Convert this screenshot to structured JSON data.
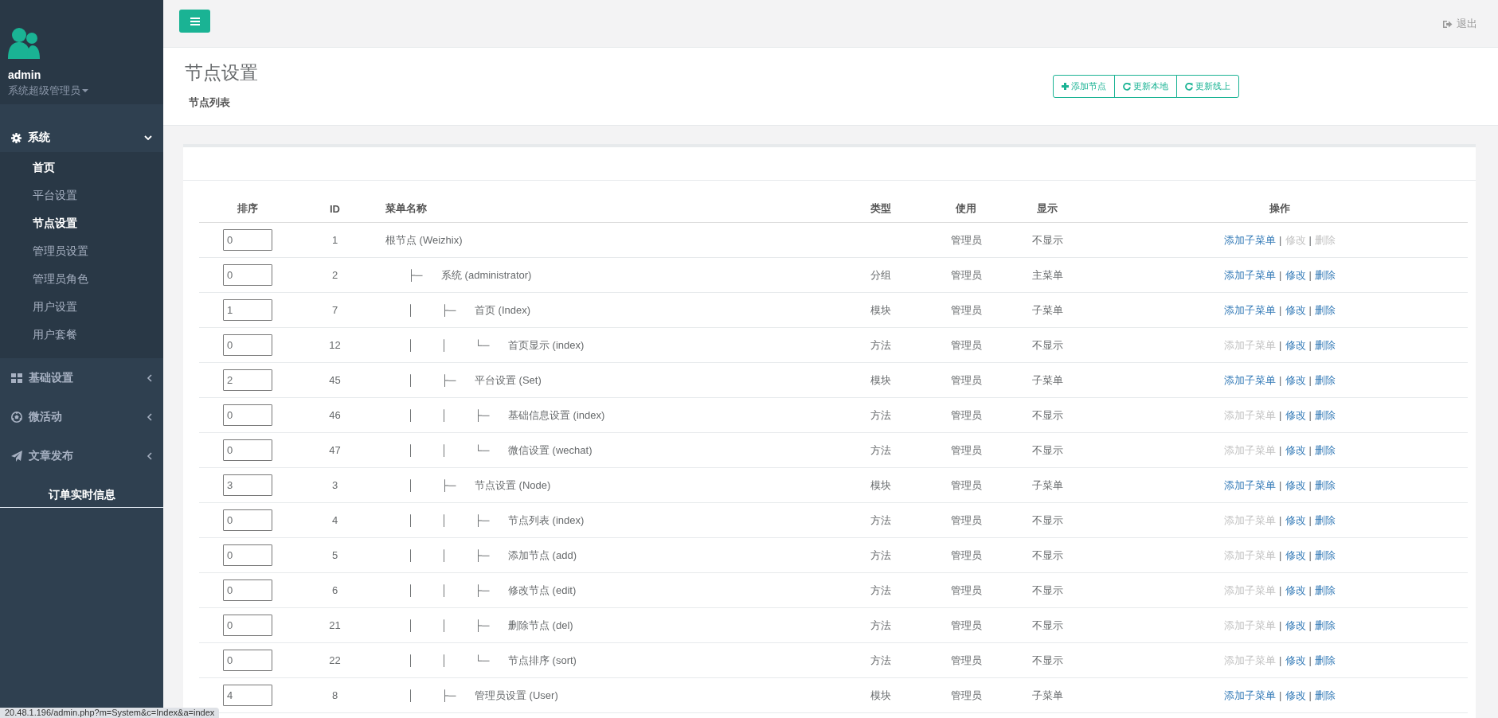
{
  "sidebar": {
    "user": {
      "name": "admin",
      "role": "系统超级管理员"
    },
    "menu": [
      {
        "kind": "group",
        "label": "系统",
        "expanded": true,
        "children": [
          {
            "label": "首页",
            "active": true
          },
          {
            "label": "平台设置",
            "active": false
          },
          {
            "label": "节点设置",
            "active": true
          },
          {
            "label": "管理员设置",
            "active": false
          },
          {
            "label": "管理员角色",
            "active": false
          },
          {
            "label": "用户设置",
            "active": false
          },
          {
            "label": "用户套餐",
            "active": false
          }
        ]
      },
      {
        "kind": "group",
        "label": "基础设置",
        "expanded": false
      },
      {
        "kind": "group",
        "label": "微活动",
        "expanded": false
      },
      {
        "kind": "group",
        "label": "文章发布",
        "expanded": false
      },
      {
        "kind": "plain",
        "label": "订单实时信息"
      }
    ]
  },
  "topbar": {
    "logout": "退出"
  },
  "header": {
    "title": "节点设置",
    "subtitle": "节点列表",
    "buttons": [
      "添加节点",
      "更新本地",
      "更新线上"
    ]
  },
  "table": {
    "columns": [
      "排序",
      "ID",
      "菜单名称",
      "类型",
      "使用",
      "显示",
      "操作"
    ],
    "rows": [
      {
        "sort": "0",
        "id": "1",
        "tree": [],
        "name": "根节点 (Weizhix)",
        "type": "",
        "use": "管理员",
        "show": "不显示",
        "actions": [
          {
            "label": "添加子菜单",
            "disabled": false
          },
          {
            "label": "修改",
            "disabled": true
          },
          {
            "label": "删除",
            "disabled": true
          }
        ]
      },
      {
        "sort": "0",
        "id": "2",
        "tree": [
          "├─"
        ],
        "name": "系统 (administrator)",
        "type": "分组",
        "use": "管理员",
        "show": "主菜单",
        "actions": [
          {
            "label": "添加子菜单",
            "disabled": false
          },
          {
            "label": "修改",
            "disabled": false
          },
          {
            "label": "删除",
            "disabled": false
          }
        ]
      },
      {
        "sort": "1",
        "id": "7",
        "tree": [
          "│",
          "├─"
        ],
        "name": "首页 (Index)",
        "type": "模块",
        "use": "管理员",
        "show": "子菜单",
        "actions": [
          {
            "label": "添加子菜单",
            "disabled": false
          },
          {
            "label": "修改",
            "disabled": false
          },
          {
            "label": "删除",
            "disabled": false
          }
        ]
      },
      {
        "sort": "0",
        "id": "12",
        "tree": [
          "│",
          "│",
          "└─"
        ],
        "name": "首页显示 (index)",
        "type": "方法",
        "use": "管理员",
        "show": "不显示",
        "actions": [
          {
            "label": "添加子菜单",
            "disabled": true
          },
          {
            "label": "修改",
            "disabled": false
          },
          {
            "label": "删除",
            "disabled": false
          }
        ]
      },
      {
        "sort": "2",
        "id": "45",
        "tree": [
          "│",
          "├─"
        ],
        "name": "平台设置 (Set)",
        "type": "模块",
        "use": "管理员",
        "show": "子菜单",
        "actions": [
          {
            "label": "添加子菜单",
            "disabled": false
          },
          {
            "label": "修改",
            "disabled": false
          },
          {
            "label": "删除",
            "disabled": false
          }
        ]
      },
      {
        "sort": "0",
        "id": "46",
        "tree": [
          "│",
          "│",
          "├─"
        ],
        "name": "基础信息设置 (index)",
        "type": "方法",
        "use": "管理员",
        "show": "不显示",
        "actions": [
          {
            "label": "添加子菜单",
            "disabled": true
          },
          {
            "label": "修改",
            "disabled": false
          },
          {
            "label": "删除",
            "disabled": false
          }
        ]
      },
      {
        "sort": "0",
        "id": "47",
        "tree": [
          "│",
          "│",
          "└─"
        ],
        "name": "微信设置 (wechat)",
        "type": "方法",
        "use": "管理员",
        "show": "不显示",
        "actions": [
          {
            "label": "添加子菜单",
            "disabled": true
          },
          {
            "label": "修改",
            "disabled": false
          },
          {
            "label": "删除",
            "disabled": false
          }
        ]
      },
      {
        "sort": "3",
        "id": "3",
        "tree": [
          "│",
          "├─"
        ],
        "name": "节点设置 (Node)",
        "type": "模块",
        "use": "管理员",
        "show": "子菜单",
        "actions": [
          {
            "label": "添加子菜单",
            "disabled": false
          },
          {
            "label": "修改",
            "disabled": false
          },
          {
            "label": "删除",
            "disabled": false
          }
        ]
      },
      {
        "sort": "0",
        "id": "4",
        "tree": [
          "│",
          "│",
          "├─"
        ],
        "name": "节点列表 (index)",
        "type": "方法",
        "use": "管理员",
        "show": "不显示",
        "actions": [
          {
            "label": "添加子菜单",
            "disabled": true
          },
          {
            "label": "修改",
            "disabled": false
          },
          {
            "label": "删除",
            "disabled": false
          }
        ]
      },
      {
        "sort": "0",
        "id": "5",
        "tree": [
          "│",
          "│",
          "├─"
        ],
        "name": "添加节点 (add)",
        "type": "方法",
        "use": "管理员",
        "show": "不显示",
        "actions": [
          {
            "label": "添加子菜单",
            "disabled": true
          },
          {
            "label": "修改",
            "disabled": false
          },
          {
            "label": "删除",
            "disabled": false
          }
        ]
      },
      {
        "sort": "0",
        "id": "6",
        "tree": [
          "│",
          "│",
          "├─"
        ],
        "name": "修改节点 (edit)",
        "type": "方法",
        "use": "管理员",
        "show": "不显示",
        "actions": [
          {
            "label": "添加子菜单",
            "disabled": true
          },
          {
            "label": "修改",
            "disabled": false
          },
          {
            "label": "删除",
            "disabled": false
          }
        ]
      },
      {
        "sort": "0",
        "id": "21",
        "tree": [
          "│",
          "│",
          "├─"
        ],
        "name": "删除节点 (del)",
        "type": "方法",
        "use": "管理员",
        "show": "不显示",
        "actions": [
          {
            "label": "添加子菜单",
            "disabled": true
          },
          {
            "label": "修改",
            "disabled": false
          },
          {
            "label": "删除",
            "disabled": false
          }
        ]
      },
      {
        "sort": "0",
        "id": "22",
        "tree": [
          "│",
          "│",
          "└─"
        ],
        "name": "节点排序 (sort)",
        "type": "方法",
        "use": "管理员",
        "show": "不显示",
        "actions": [
          {
            "label": "添加子菜单",
            "disabled": true
          },
          {
            "label": "修改",
            "disabled": false
          },
          {
            "label": "删除",
            "disabled": false
          }
        ]
      },
      {
        "sort": "4",
        "id": "8",
        "tree": [
          "│",
          "├─"
        ],
        "name": "管理员设置 (User)",
        "type": "模块",
        "use": "管理员",
        "show": "子菜单",
        "actions": [
          {
            "label": "添加子菜单",
            "disabled": false
          },
          {
            "label": "修改",
            "disabled": false
          },
          {
            "label": "删除",
            "disabled": false
          }
        ]
      }
    ],
    "separator": "|"
  },
  "status_bar": {
    "url": "20.48.1.196/admin.php?m=System&c=Index&a=index"
  }
}
